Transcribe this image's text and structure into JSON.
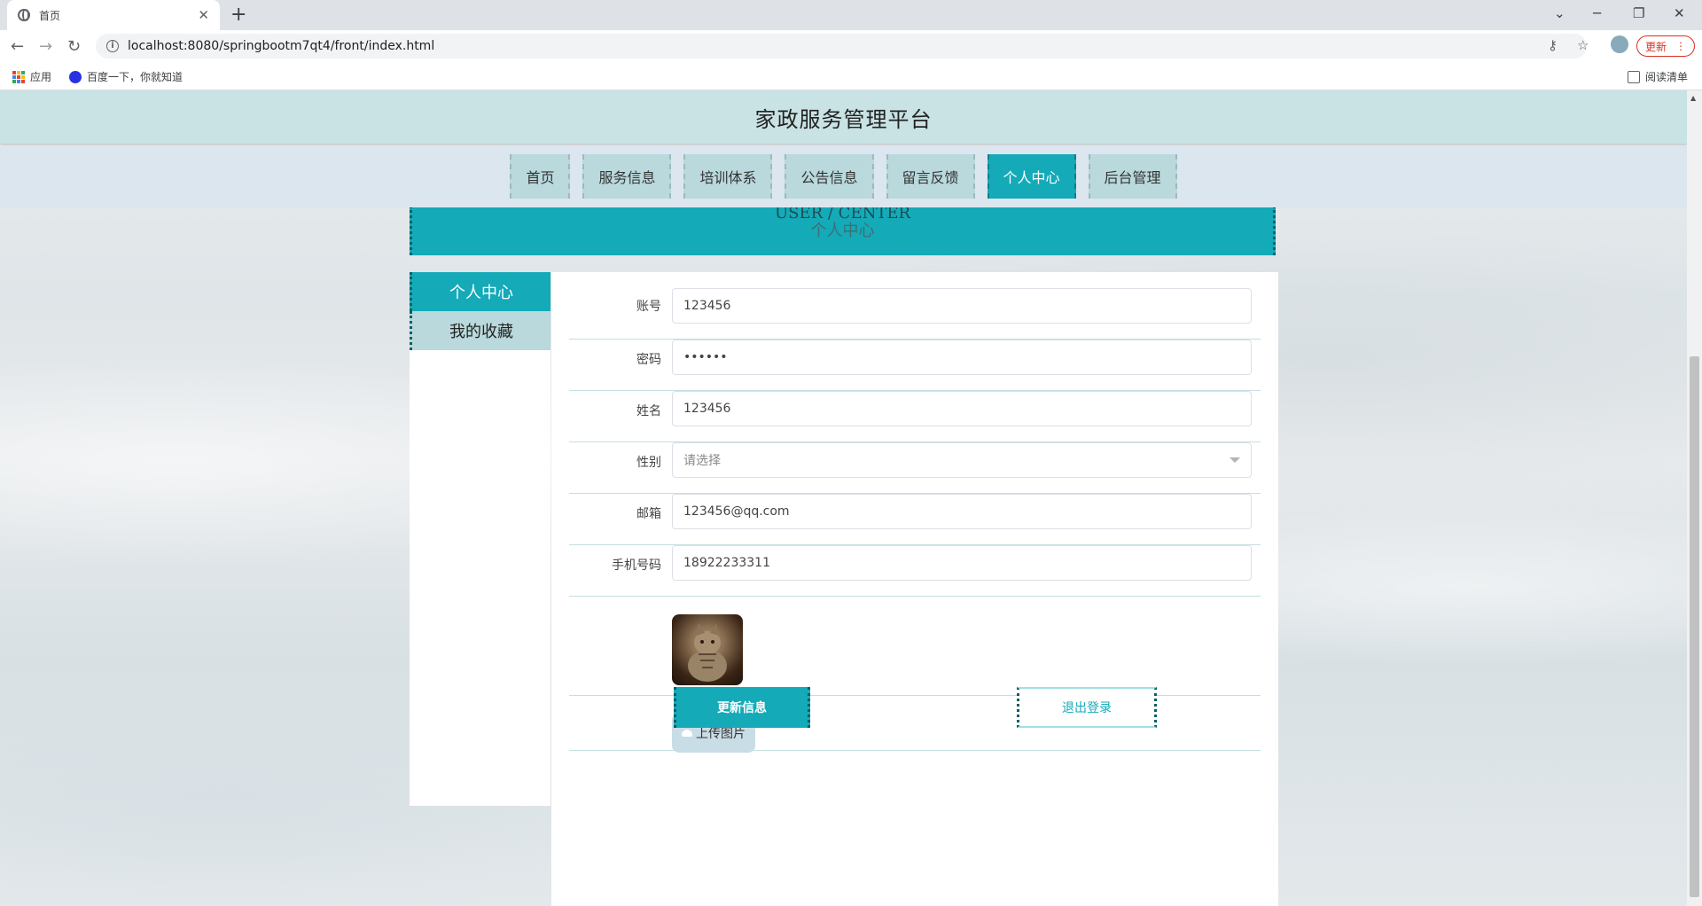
{
  "browser": {
    "tab_title": "首页",
    "tab_close": "✕",
    "new_tab": "+",
    "url": "localhost:8080/springbootm7qt4/front/index.html",
    "update_label": "更新",
    "update_menu": "⋮",
    "controls": {
      "minimize": "─",
      "restore": "❐",
      "close": "✕"
    },
    "nav": {
      "back": "←",
      "forward": "→",
      "reload": "↻"
    },
    "omni_icons": {
      "key": "⚷",
      "star": "☆"
    },
    "bookmarks": [
      {
        "label": "应用",
        "icon": "apps-grid-icon"
      },
      {
        "label": "百度一下，你就知道",
        "icon": "baidu-paw-icon"
      }
    ],
    "reading_list": "阅读清单"
  },
  "site": {
    "title": "家政服务管理平台",
    "nav": [
      {
        "label": "首页",
        "active": false
      },
      {
        "label": "服务信息",
        "active": false
      },
      {
        "label": "培训体系",
        "active": false
      },
      {
        "label": "公告信息",
        "active": false
      },
      {
        "label": "留言反馈",
        "active": false
      },
      {
        "label": "个人中心",
        "active": true
      },
      {
        "label": "后台管理",
        "active": false
      }
    ],
    "banner": {
      "en": "USER / CENTER",
      "cn": "个人中心"
    }
  },
  "side_menu": [
    {
      "label": "个人中心",
      "active": true
    },
    {
      "label": "我的收藏",
      "active": false
    }
  ],
  "form": {
    "fields": [
      {
        "label": "账号",
        "value": "123456"
      },
      {
        "label": "密码",
        "value": "••••••"
      },
      {
        "label": "姓名",
        "value": "123456"
      },
      {
        "label": "性别",
        "value": "请选择",
        "placeholder": true
      },
      {
        "label": "邮箱",
        "value": "123456@qq.com"
      },
      {
        "label": "手机号码",
        "value": "18922233311"
      }
    ],
    "upload_label": "上传图片",
    "update_button": "更新信息",
    "logout_button": "退出登录"
  },
  "colors": {
    "accent": "#14aab8",
    "nav_item": "#b9d9dc",
    "header_bg": "#c9e2e4"
  }
}
